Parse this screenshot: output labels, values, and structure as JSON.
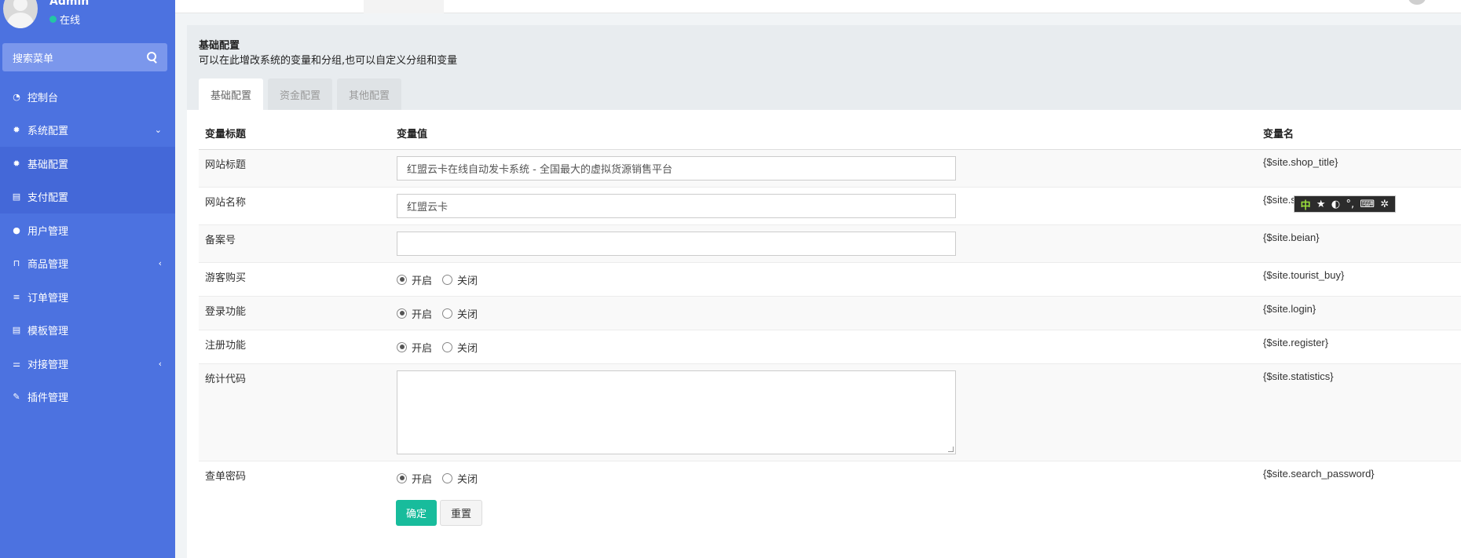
{
  "sidebar": {
    "user_name": "Admin",
    "user_status": "在线",
    "search_placeholder": "搜索菜单",
    "items": [
      {
        "label": "控制台",
        "icon": "dashboard-icon"
      },
      {
        "label": "系统配置",
        "icon": "gear-icon"
      },
      {
        "label": "基础配置",
        "icon": "gear-icon"
      },
      {
        "label": "支付配置",
        "icon": "table-icon"
      },
      {
        "label": "用户管理",
        "icon": "user-icon"
      },
      {
        "label": "商品管理",
        "icon": "cart-icon"
      },
      {
        "label": "订单管理",
        "icon": "list-icon"
      },
      {
        "label": "模板管理",
        "icon": "table-icon"
      },
      {
        "label": "对接管理",
        "icon": "sliders-icon"
      },
      {
        "label": "插件管理",
        "icon": "plug-icon"
      }
    ]
  },
  "page": {
    "title": "基础配置",
    "description": "可以在此增改系统的变量和分组,也可以自定义分组和变量",
    "tabs": [
      "基础配置",
      "资金配置",
      "其他配置"
    ]
  },
  "table": {
    "headers": [
      "变量标题",
      "变量值",
      "变量名"
    ],
    "rows": [
      {
        "title": "网站标题",
        "type": "text",
        "value": "红盟云卡在线自动发卡系统 - 全国最大的虚拟货源销售平台",
        "var": "{$site.shop_title}"
      },
      {
        "title": "网站名称",
        "type": "text",
        "value": "红盟云卡",
        "var": "{$site.s"
      },
      {
        "title": "备案号",
        "type": "text",
        "value": "",
        "var": "{$site.beian}"
      },
      {
        "title": "游客购买",
        "type": "radio",
        "var": "{$site.tourist_buy}"
      },
      {
        "title": "登录功能",
        "type": "radio",
        "var": "{$site.login}"
      },
      {
        "title": "注册功能",
        "type": "radio",
        "var": "{$site.register}"
      },
      {
        "title": "统计代码",
        "type": "textarea",
        "var": "{$site.statistics}"
      },
      {
        "title": "查单密码",
        "type": "radio",
        "var": "{$site.search_password}"
      }
    ],
    "radio_on": "开启",
    "radio_off": "关闭"
  },
  "buttons": {
    "confirm": "确定",
    "reset": "重置"
  },
  "ime": {
    "mode": "中"
  }
}
